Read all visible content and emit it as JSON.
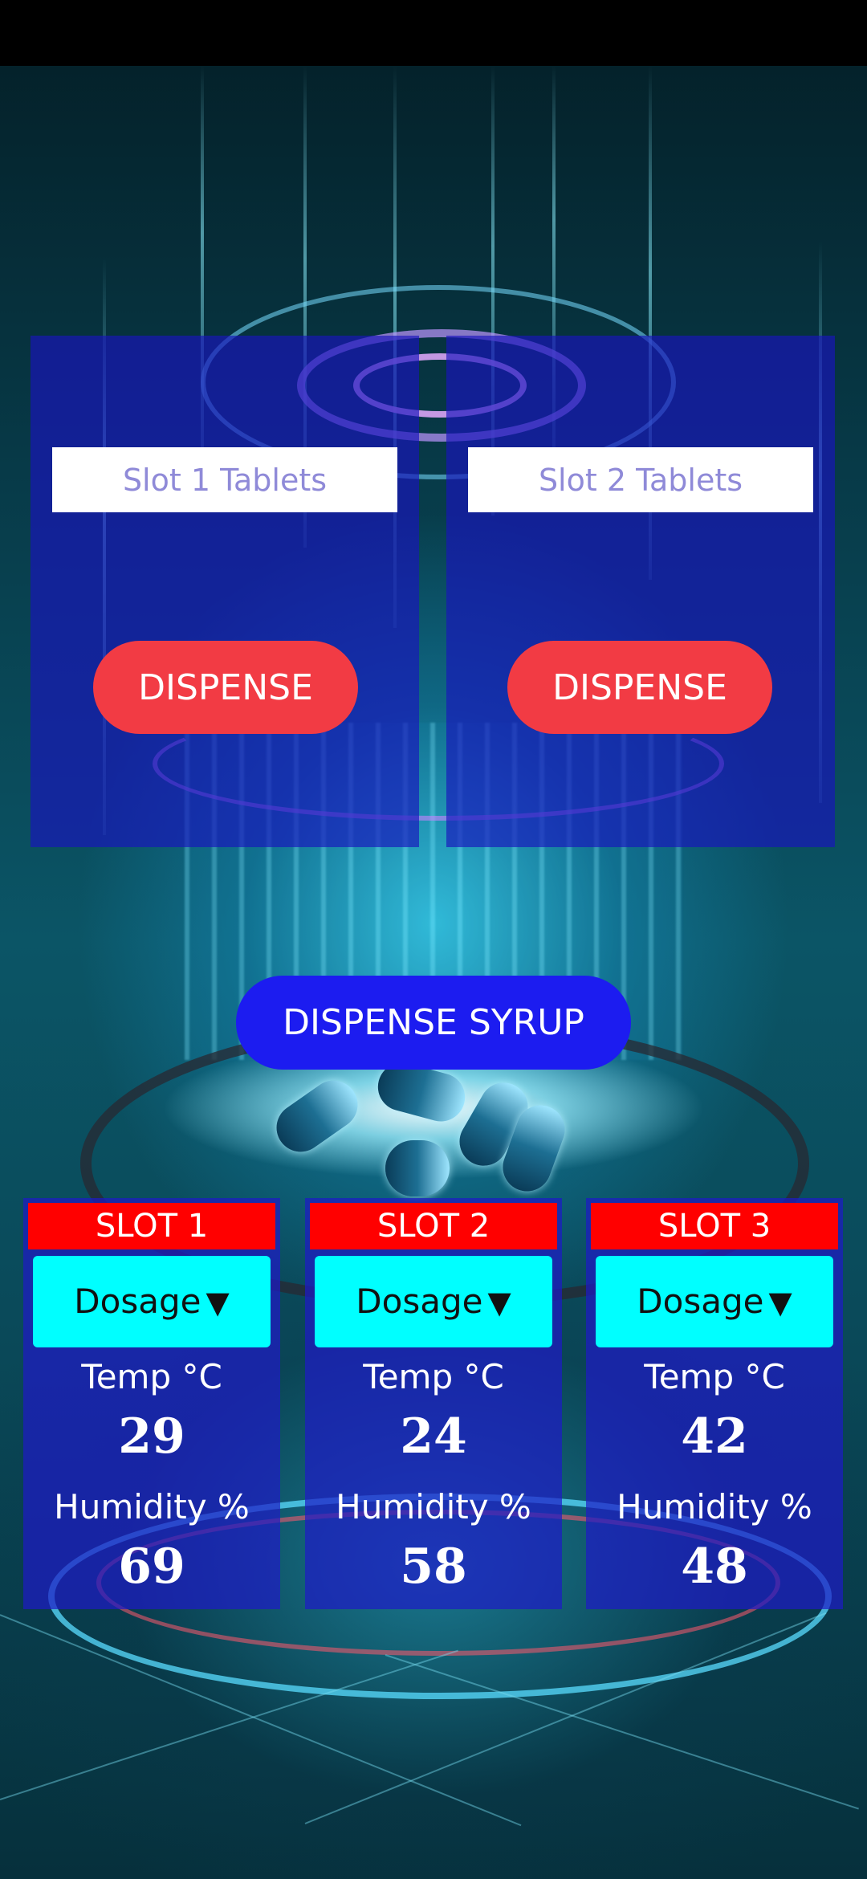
{
  "tablets": [
    {
      "placeholder": "Slot 1 Tablets",
      "dispense_label": "DISPENSE"
    },
    {
      "placeholder": "Slot 2 Tablets",
      "dispense_label": "DISPENSE"
    }
  ],
  "syrup": {
    "label": "DISPENSE SYRUP"
  },
  "slots": [
    {
      "title": "SLOT 1",
      "dosage_label": "Dosage",
      "dosage_arrow": "▼",
      "temp_label": "Temp °C",
      "temp_value": "29",
      "humidity_label": "Humidity %",
      "humidity_value": "69"
    },
    {
      "title": "SLOT 2",
      "dosage_label": "Dosage",
      "dosage_arrow": "▼",
      "temp_label": "Temp °C",
      "temp_value": "24",
      "humidity_label": "Humidity %",
      "humidity_value": "58"
    },
    {
      "title": "SLOT 3",
      "dosage_label": "Dosage",
      "dosage_arrow": "▼",
      "temp_label": "Temp °C",
      "temp_value": "42",
      "humidity_label": "Humidity %",
      "humidity_value": "48"
    }
  ],
  "colors": {
    "dispense_button": "#f23b44",
    "syrup_button": "#1c1cf0",
    "slot_header": "#ff0000",
    "dosage_select": "#00ffff",
    "panel": "#1914be"
  }
}
